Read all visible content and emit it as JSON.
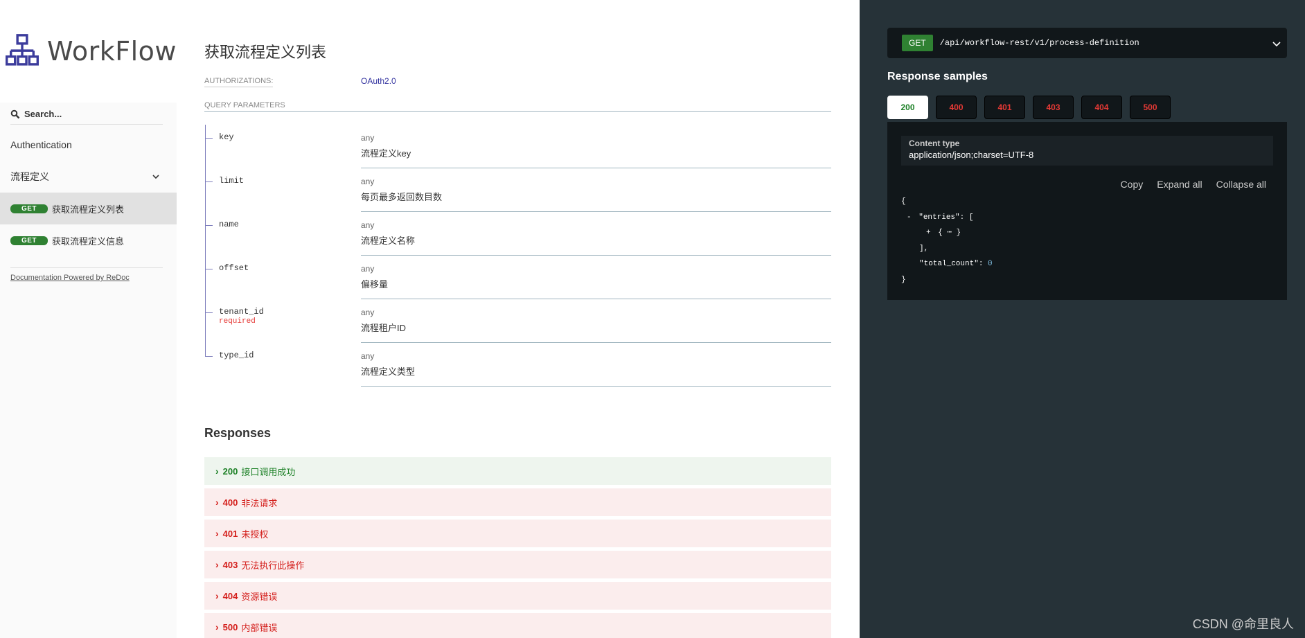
{
  "sidebar": {
    "logo_text": "WorkFlow",
    "search_placeholder": "Search...",
    "items": [
      {
        "label": "Authentication"
      },
      {
        "label": "流程定义"
      }
    ],
    "sub_items": [
      {
        "method": "GET",
        "label": "获取流程定义列表"
      },
      {
        "method": "GET",
        "label": "获取流程定义信息"
      }
    ],
    "powered_by": "Documentation Powered by ReDoc"
  },
  "operation": {
    "title": "获取流程定义列表",
    "authorizations_label": "AUTHORIZATIONS:",
    "authorizations_value": "OAuth2.0",
    "query_params_label": "QUERY PARAMETERS",
    "params": [
      {
        "name": "key",
        "required": "",
        "type": "any",
        "desc": "流程定义key"
      },
      {
        "name": "limit",
        "required": "",
        "type": "any",
        "desc": "每页最多返回数目数"
      },
      {
        "name": "name",
        "required": "",
        "type": "any",
        "desc": "流程定义名称"
      },
      {
        "name": "offset",
        "required": "",
        "type": "any",
        "desc": "偏移量"
      },
      {
        "name": "tenant_id",
        "required": "required",
        "type": "any",
        "desc": "流程租户ID"
      },
      {
        "name": "type_id",
        "required": "",
        "type": "any",
        "desc": "流程定义类型"
      }
    ],
    "responses_title": "Responses",
    "responses": [
      {
        "code": "200",
        "desc": "接口调用成功"
      },
      {
        "code": "400",
        "desc": "非法请求"
      },
      {
        "code": "401",
        "desc": "未授权"
      },
      {
        "code": "403",
        "desc": "无法执行此操作"
      },
      {
        "code": "404",
        "desc": "资源错误"
      },
      {
        "code": "500",
        "desc": "内部错误"
      }
    ]
  },
  "right_panel": {
    "method": "GET",
    "path": "/api/workflow-rest/v1/process-definition",
    "samples_title": "Response samples",
    "tabs": [
      "200",
      "400",
      "401",
      "403",
      "404",
      "500"
    ],
    "content_type_label": "Content type",
    "content_type_value": "application/json;charset=UTF-8",
    "controls": {
      "copy": "Copy",
      "expand": "Expand all",
      "collapse": "Collapse all"
    },
    "json_lines": {
      "l1": "{",
      "l2_toggle": "-",
      "l2_key": "\"entries\"",
      "l2_rest": ": [",
      "l3_toggle": "+",
      "l3_rest": "{ ⋯ }",
      "l4": "],",
      "l5_key": "\"total_count\"",
      "l5_sep": ":",
      "l5_val": "0",
      "l6": "}"
    },
    "watermark": "CSDN @命里良人"
  },
  "colors": {
    "get_green": "#2f8132",
    "error_red": "#d41f1c",
    "panel_dark": "#263238",
    "link_blue": "#32329f"
  }
}
